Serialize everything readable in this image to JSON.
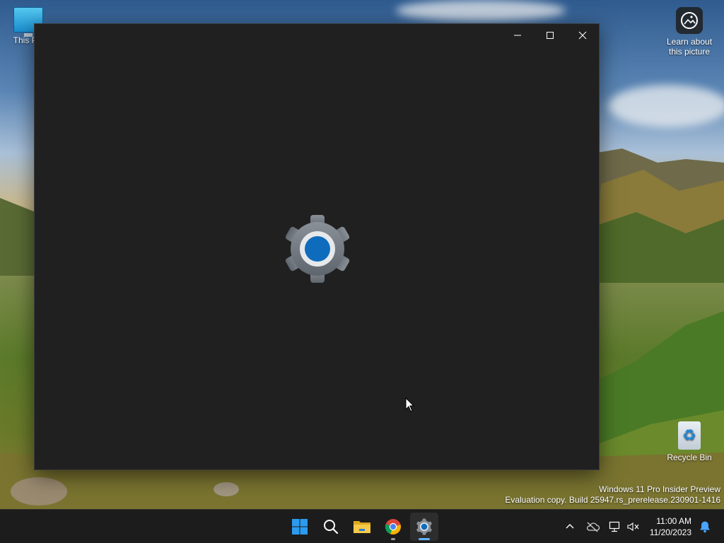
{
  "desktop": {
    "icons": {
      "this_pc": "This PC",
      "learn": "Learn about this picture",
      "recycle_bin": "Recycle Bin"
    },
    "watermark": {
      "line1": "Windows 11 Pro Insider Preview",
      "line2": "Evaluation copy. Build 25947.rs_prerelease.230901-1416"
    }
  },
  "window": {
    "app": "Settings",
    "icon": "settings-gear-icon",
    "state": "loading-splash",
    "controls": [
      "minimize",
      "maximize",
      "close"
    ]
  },
  "taskbar": {
    "pinned": [
      {
        "name": "start-button",
        "icon": "windows-logo-icon"
      },
      {
        "name": "search-button",
        "icon": "search-icon"
      },
      {
        "name": "file-explorer-button",
        "icon": "folder-icon"
      },
      {
        "name": "chrome-button",
        "icon": "chrome-icon",
        "running": true
      },
      {
        "name": "settings-button",
        "icon": "settings-gear-icon",
        "running": true,
        "active": true
      }
    ],
    "tray": {
      "icons": [
        "chevron-up-icon",
        "onedrive-offline-icon",
        "network-icon",
        "volume-muted-icon",
        "notification-bell-icon"
      ]
    },
    "clock": {
      "time": "11:00 AM",
      "date": "11/20/2023"
    }
  },
  "colors": {
    "window_bg": "#202020",
    "taskbar_bg": "#1c1c1c",
    "accent": "#0f6cbd",
    "active_indicator": "#60b3ff"
  }
}
